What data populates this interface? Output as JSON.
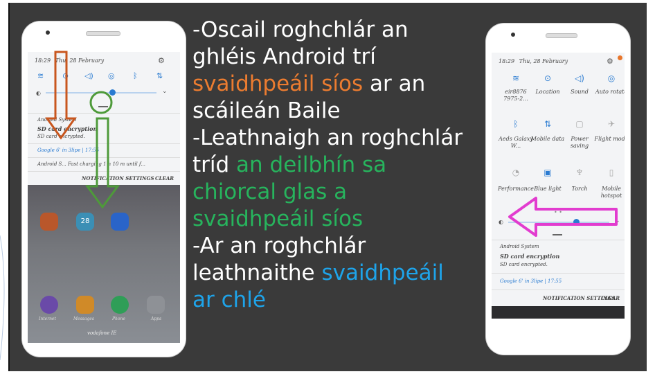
{
  "instructions": {
    "l1a": "-Oscail roghchlár an",
    "l2a": "ghléis Android trí",
    "l3_orange": "svaidhpeáil síos",
    "l3_rest": " ar an",
    "l4a": "scáileán Baile",
    "l5a": "-Leathnaigh an roghchlár",
    "l6a": "tríd ",
    "l6_green": "an deilbhín sa",
    "l7_green": "chiorcal glas a",
    "l8_green": "svaidhpeáil síos",
    "l9a": "-Ar an roghchlár",
    "l10a": "leathnaithe ",
    "l10_blue": "svaidhpeáil",
    "l11_blue": "ar chlé"
  },
  "left_phone": {
    "status_time": "18:29",
    "status_date": "Thu, 28 February",
    "notif_app": "Android System",
    "notif_title": "SD card encryption",
    "notif_sub": "SD card encrypted.",
    "google_row": "Google  6' in 3lipe  |  17:55",
    "android_row": "Android S...  Fast charging  1 h 10 m until f...",
    "notif_settings": "NOTIFICATION SETTINGS",
    "clear": "CLEAR",
    "carrier": "vodafone IE",
    "app_labels": [
      "Internet",
      "Messages",
      "Phone",
      "Apps"
    ],
    "calendar_day": "28"
  },
  "right_phone": {
    "status_time": "18:29",
    "status_date": "Thu, 28 February",
    "tiles_row1": [
      "eir8876 7975-2...",
      "Location",
      "Sound",
      "Auto rotate"
    ],
    "tiles_row2": [
      "Aeds Galaxy W...",
      "Mobile data",
      "Power saving",
      "Flight mode"
    ],
    "tiles_row3": [
      "Performance",
      "Blue light",
      "Torch",
      "Mobile hotspot"
    ],
    "notif_app": "Android System",
    "notif_title": "SD card encryption",
    "notif_sub": "SD card encrypted.",
    "google_row": "Google  6' in 3lipe  |  17:55",
    "notif_settings": "NOTIFICATION SETTINGS",
    "clear": "CLEAR"
  },
  "colors": {
    "panel": "#3a3a3a",
    "orange_arrow": "#c8561e",
    "green_arrow": "#4e9a3a",
    "magenta_arrow": "#e23ccf",
    "blue_text": "#1ea4ea",
    "green_text": "#27b45d",
    "orange_text": "#ec7c30"
  }
}
